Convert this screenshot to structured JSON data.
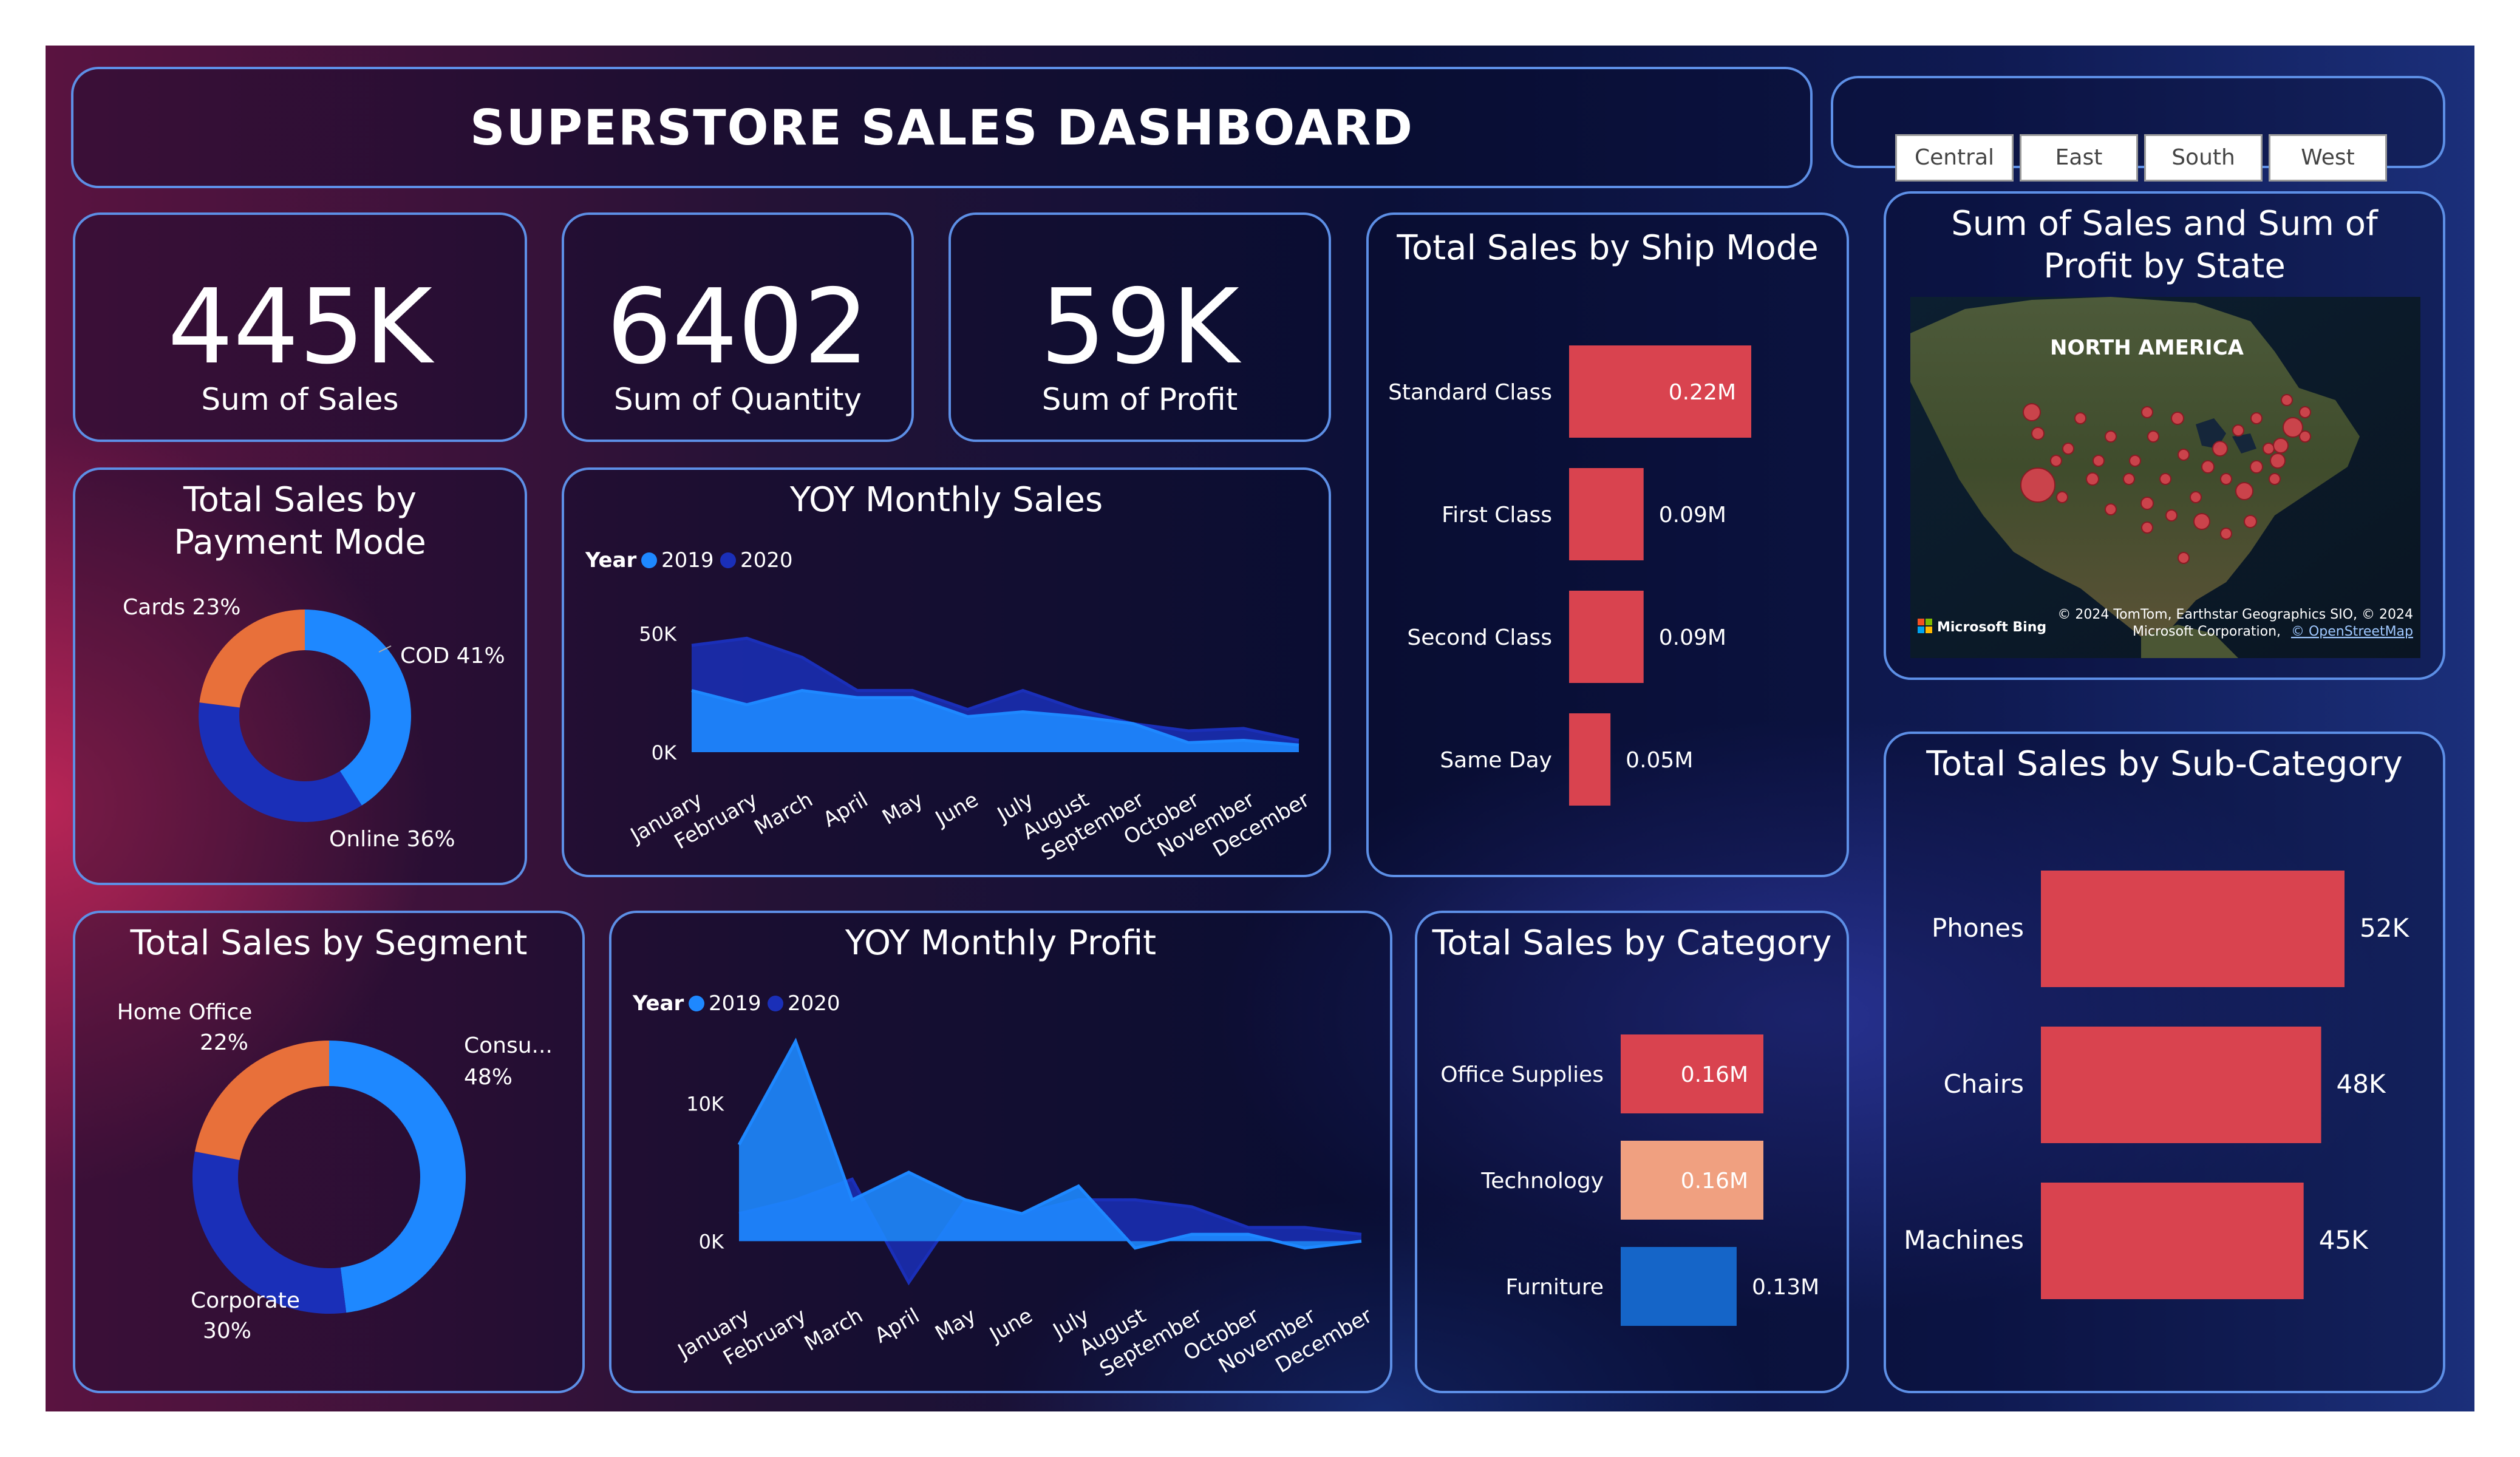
{
  "title": "SUPERSTORE SALES DASHBOARD",
  "slicer": [
    "Central",
    "East",
    "South",
    "West"
  ],
  "kpis": [
    {
      "value": "445K",
      "label": "Sum of Sales"
    },
    {
      "value": "6402",
      "label": "Sum of Quantity"
    },
    {
      "value": "59K",
      "label": "Sum of Profit"
    }
  ],
  "colors": {
    "series_2019": "#1e88ff",
    "series_2020": "#1a2fb8",
    "bar": "#d9434f",
    "orange": "#e8703a",
    "tech": "#f0a080",
    "furniture": "#1565c8"
  },
  "payment": {
    "title": "Total Sales by Payment Mode",
    "slices": [
      {
        "label": "COD 41%",
        "value": 41,
        "color": "#1e88ff"
      },
      {
        "label": "Online 36%",
        "value": 36,
        "color": "#1a2fb8"
      },
      {
        "label": "Cards 23%",
        "value": 23,
        "color": "#e8703a"
      }
    ]
  },
  "segment": {
    "title": "Total Sales by Segment",
    "slices": [
      {
        "label": "Consu...",
        "pct": "48%",
        "value": 48,
        "color": "#1e88ff"
      },
      {
        "label": "Corporate",
        "pct": "30%",
        "value": 30,
        "color": "#1a2fb8"
      },
      {
        "label": "Home Office",
        "pct": "22%",
        "value": 22,
        "color": "#e8703a"
      }
    ]
  },
  "yoy_sales": {
    "title": "YOY Monthly Sales",
    "legend_title": "Year",
    "ytick_labels": [
      "50K",
      "0K"
    ],
    "chart_data": {
      "type": "area",
      "categories": [
        "January",
        "February",
        "March",
        "April",
        "May",
        "June",
        "July",
        "August",
        "September",
        "October",
        "November",
        "December"
      ],
      "yticks": [
        50000,
        0
      ],
      "ylim": [
        0,
        55000
      ],
      "series": [
        {
          "name": "2019",
          "values": [
            26000,
            20000,
            26000,
            23000,
            23000,
            15000,
            17000,
            15000,
            12000,
            4000,
            5000,
            3000
          ]
        },
        {
          "name": "2020",
          "values": [
            45000,
            48000,
            40000,
            26000,
            26000,
            18000,
            26000,
            18000,
            12000,
            9000,
            10000,
            5000
          ]
        }
      ]
    }
  },
  "yoy_profit": {
    "title": "YOY Monthly Profit",
    "legend_title": "Year",
    "ytick_labels": [
      "10K",
      "0K"
    ],
    "chart_data": {
      "type": "area",
      "categories": [
        "January",
        "February",
        "March",
        "April",
        "May",
        "June",
        "July",
        "August",
        "September",
        "October",
        "November",
        "December"
      ],
      "yticks": [
        10000,
        0
      ],
      "ylim": [
        -3500,
        15000
      ],
      "series": [
        {
          "name": "2019",
          "values": [
            7000,
            14500,
            3000,
            5000,
            3000,
            2000,
            4000,
            -500,
            500,
            500,
            -500,
            0
          ]
        },
        {
          "name": "2020",
          "values": [
            2000,
            3000,
            4500,
            -3000,
            3000,
            2000,
            3000,
            3000,
            2500,
            1000,
            1000,
            500
          ]
        }
      ]
    }
  },
  "ship_mode": {
    "title": "Total Sales by Ship Mode",
    "chart_data": {
      "type": "bar",
      "categories": [
        "Standard Class",
        "First Class",
        "Second Class",
        "Same Day"
      ],
      "values": [
        0.22,
        0.09,
        0.09,
        0.05
      ],
      "labels": [
        "0.22M",
        "0.09M",
        "0.09M",
        "0.05M"
      ]
    }
  },
  "category": {
    "title": "Total Sales by Category",
    "chart_data": {
      "type": "bar",
      "categories": [
        "Office Supplies",
        "Technology",
        "Furniture"
      ],
      "values": [
        0.16,
        0.16,
        0.13
      ],
      "labels": [
        "0.16M",
        "0.16M",
        "0.13M"
      ]
    }
  },
  "subcategory": {
    "title": "Total Sales by Sub-Category",
    "chart_data": {
      "type": "bar",
      "categories": [
        "Phones",
        "Chairs",
        "Machines"
      ],
      "values": [
        52,
        48,
        45
      ],
      "labels": [
        "52K",
        "48K",
        "45K"
      ]
    }
  },
  "map": {
    "title": "Sum of Sales and Sum of Profit by State",
    "region_label": "NORTH AMERICA",
    "logo": "Microsoft Bing",
    "attribution_1": "© 2024 TomTom, Earthstar Geographics SIO, © 2024",
    "attribution_2": "Microsoft Corporation,",
    "attribution_link": "© OpenStreetMap"
  }
}
